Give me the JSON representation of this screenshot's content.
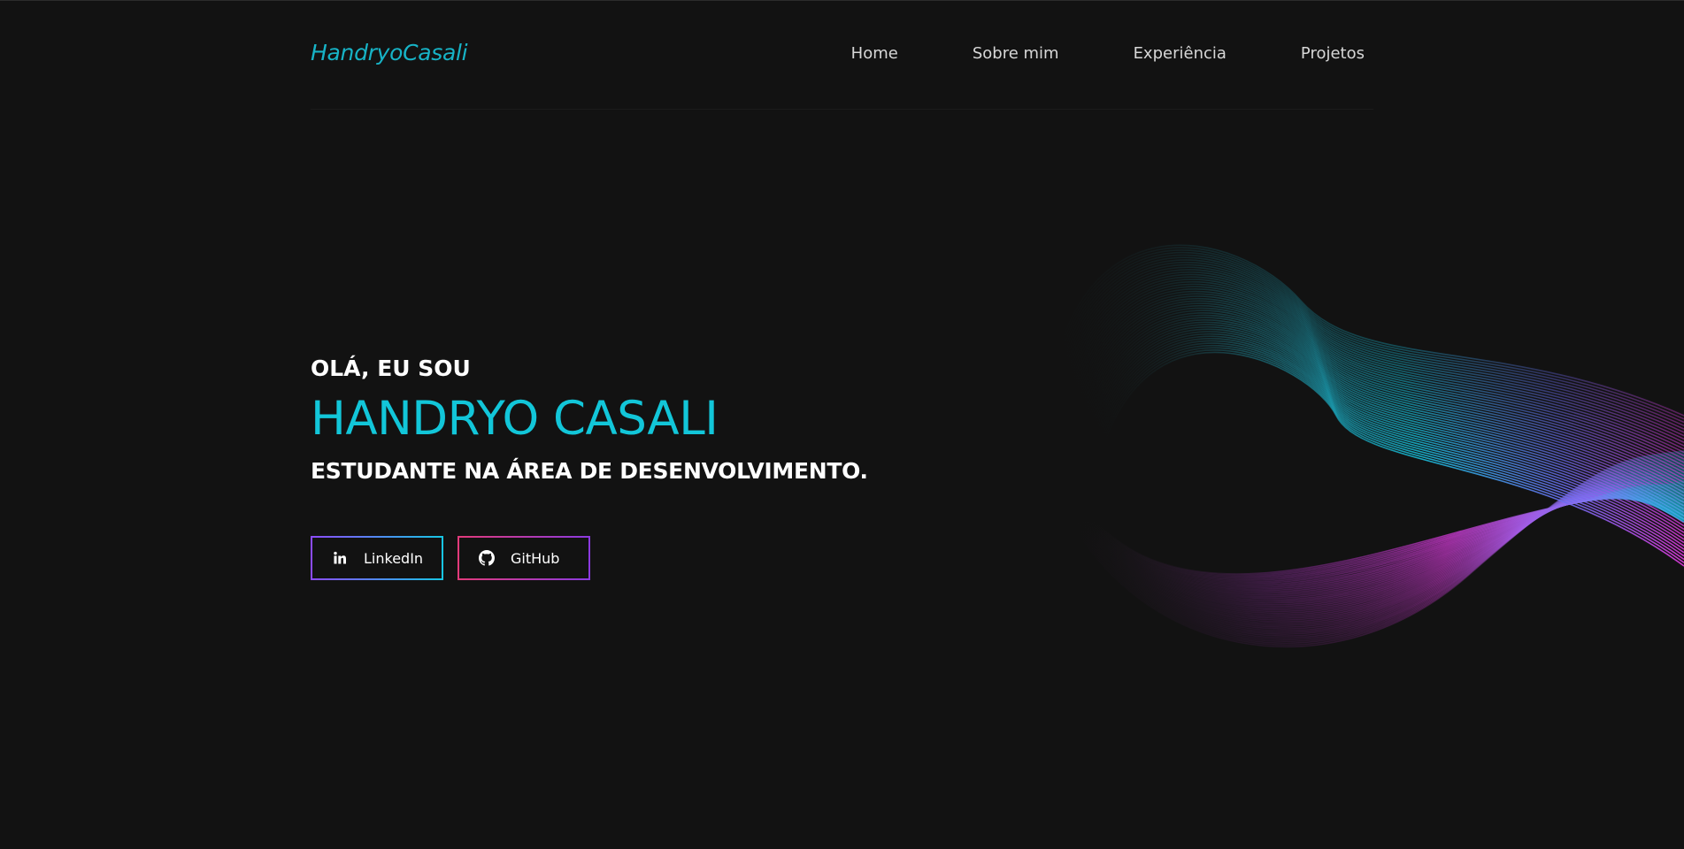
{
  "header": {
    "logo": "HandryoCasali",
    "nav": [
      {
        "label": "Home"
      },
      {
        "label": "Sobre mim"
      },
      {
        "label": "Experiência"
      },
      {
        "label": "Projetos"
      }
    ]
  },
  "hero": {
    "greeting": "OLÁ, EU SOU",
    "name": "HANDRYO CASALI",
    "subtitle": "ESTUDANTE NA ÁREA DE DESENVOLVIMENTO."
  },
  "social": {
    "linkedin": {
      "label": "LinkedIn",
      "icon": "linkedin-icon"
    },
    "github": {
      "label": "GitHub",
      "icon": "github-icon"
    }
  },
  "colors": {
    "background": "#121212",
    "accent_cyan": "#12c6d9",
    "accent_magenta": "#e23ae0",
    "accent_purple": "#8c4bff"
  }
}
